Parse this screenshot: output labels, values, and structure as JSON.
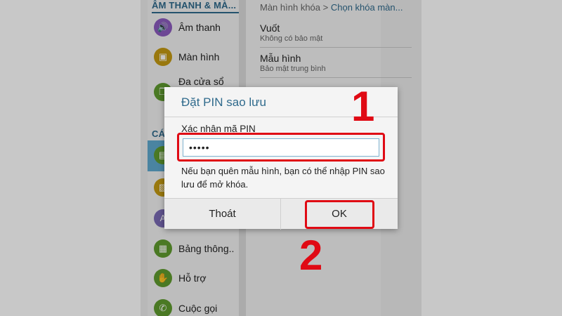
{
  "left_menu": {
    "section_sound": "ÂM THANH & MÀ...",
    "items": [
      {
        "label": "Âm thanh",
        "icon": "speaker-icon",
        "color": "#8c5bbf"
      },
      {
        "label": "Màn hình",
        "icon": "display-icon",
        "color": "#c59a13"
      },
      {
        "label": "Đa cửa sổ",
        "icon": "multiwindow-icon",
        "color": "#5f9b2f"
      },
      {
        "label": "",
        "icon": "lockscreen-icon",
        "color": "#5f9b2f"
      },
      {
        "label": "",
        "icon": "image-icon",
        "color": "#c59a13"
      },
      {
        "label": "",
        "icon": "font-icon",
        "color": "#7a6bb5"
      },
      {
        "label": "Bảng thông..",
        "icon": "panel-icon",
        "color": "#5f9b2f"
      },
      {
        "label": "Hỗ trợ",
        "icon": "hand-icon",
        "color": "#5f9b2f"
      },
      {
        "label": "Cuộc gọi",
        "icon": "phone-icon",
        "color": "#5f9b2f"
      }
    ],
    "section_second": "CÁ"
  },
  "right_pane": {
    "breadcrumb_parent": "Màn hình khóa",
    "breadcrumb_sep": ">",
    "breadcrumb_current": "Chọn khóa màn...",
    "options": [
      {
        "title": "Vuốt",
        "subtitle": "Không có bảo mật"
      },
      {
        "title": "Mẫu hình",
        "subtitle": "Bảo mật trung bình"
      }
    ]
  },
  "dialog": {
    "title": "Đặt PIN sao lưu",
    "field_label": "Xác nhận mã PIN",
    "pin_value": "•••••",
    "hint": "Nếu bạn quên mẫu hình, bạn có thể nhập PIN sao lưu để mở khóa.",
    "cancel_label": "Thoát",
    "ok_label": "OK"
  },
  "annotations": {
    "step1": "1",
    "step2": "2",
    "color": "#e00a14"
  }
}
